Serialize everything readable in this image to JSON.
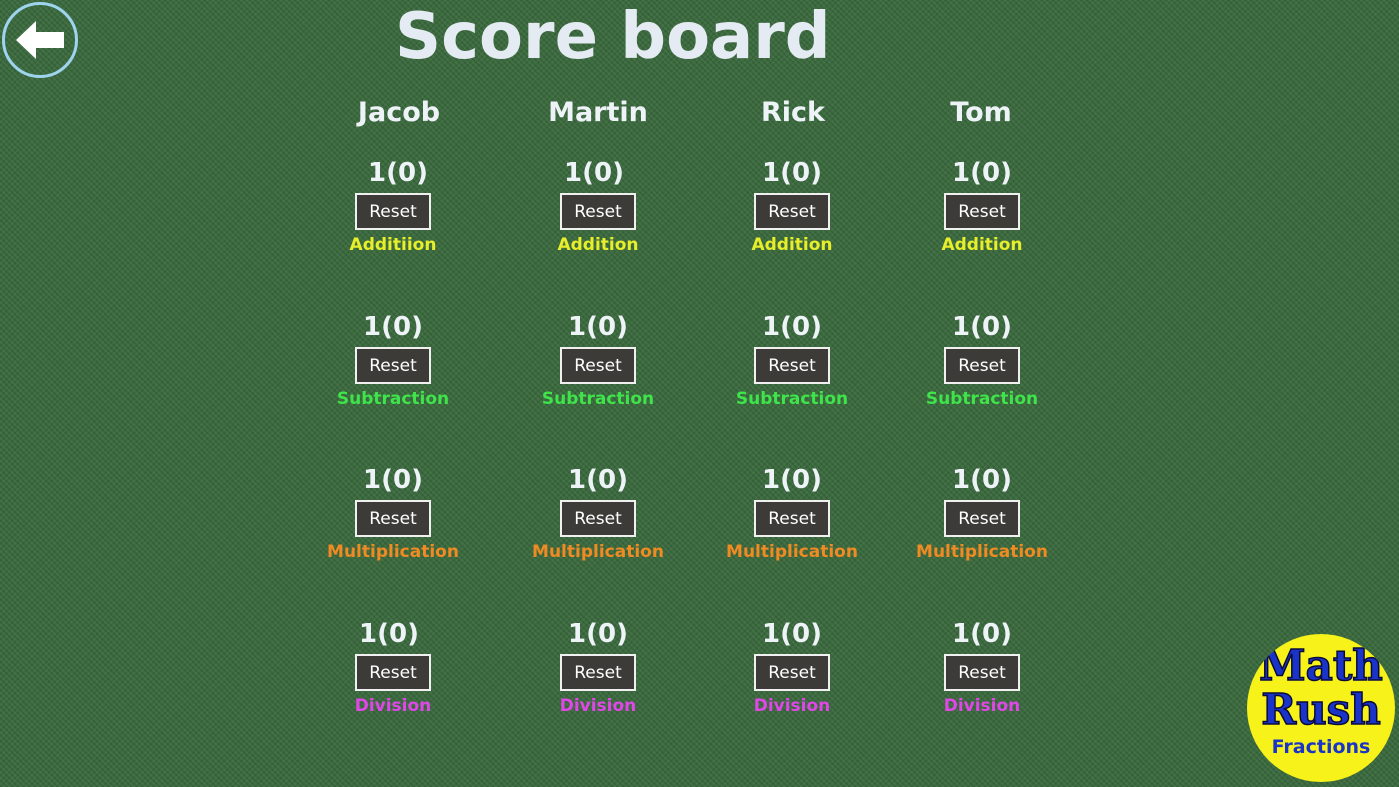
{
  "page": {
    "title": "Score board",
    "back_icon": "arrow-left-icon"
  },
  "players": [
    {
      "name": "Jacob",
      "categories": [
        {
          "score": "1(0)",
          "reset_label": "Reset",
          "operation": "Additiion"
        },
        {
          "score": "1(0)",
          "reset_label": "Reset",
          "operation": "Subtraction"
        },
        {
          "score": "1(0)",
          "reset_label": "Reset",
          "operation": "Multiplication"
        },
        {
          "score": "1(0)",
          "reset_label": "Reset",
          "operation": "Division"
        }
      ]
    },
    {
      "name": "Martin",
      "categories": [
        {
          "score": "1(0)",
          "reset_label": "Reset",
          "operation": "Addition"
        },
        {
          "score": "1(0)",
          "reset_label": "Reset",
          "operation": "Subtraction"
        },
        {
          "score": "1(0)",
          "reset_label": "Reset",
          "operation": "Multiplication"
        },
        {
          "score": "1(0)",
          "reset_label": "Reset",
          "operation": "Division"
        }
      ]
    },
    {
      "name": "Rick",
      "categories": [
        {
          "score": "1(0)",
          "reset_label": "Reset",
          "operation": "Addition"
        },
        {
          "score": "1(0)",
          "reset_label": "Reset",
          "operation": "Subtraction"
        },
        {
          "score": "1(0)",
          "reset_label": "Reset",
          "operation": "Multiplication"
        },
        {
          "score": "1(0)",
          "reset_label": "Reset",
          "operation": "Division"
        }
      ]
    },
    {
      "name": "Tom",
      "categories": [
        {
          "score": "1(0)",
          "reset_label": "Reset",
          "operation": "Addition"
        },
        {
          "score": "1(0)",
          "reset_label": "Reset",
          "operation": "Subtraction"
        },
        {
          "score": "1(0)",
          "reset_label": "Reset",
          "operation": "Multiplication"
        },
        {
          "score": "1(0)",
          "reset_label": "Reset",
          "operation": "Division"
        }
      ]
    }
  ],
  "colors": {
    "background": "#3b6b3e",
    "addition": "#e7ee2a",
    "subtraction": "#3ee44a",
    "multiplication": "#f08a22",
    "division": "#e046e8"
  },
  "logo": {
    "line1": "Math",
    "line2": "Rush",
    "subtitle": "Fractions"
  }
}
